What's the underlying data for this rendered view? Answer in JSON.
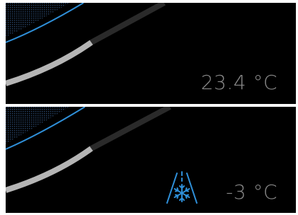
{
  "panels": [
    {
      "temperature": "23.4 °C",
      "progress": 0.55,
      "icons": []
    },
    {
      "temperature": "-3 °C",
      "progress": 0.55,
      "icons": [
        "icy-road-warning-icon"
      ]
    }
  ],
  "colors": {
    "background": "#000000",
    "track_active": "#b5b5b5",
    "track_inactive": "#2a2a2a",
    "accent": "#2f8fd8",
    "temperature_text": "#8a8a8a"
  }
}
